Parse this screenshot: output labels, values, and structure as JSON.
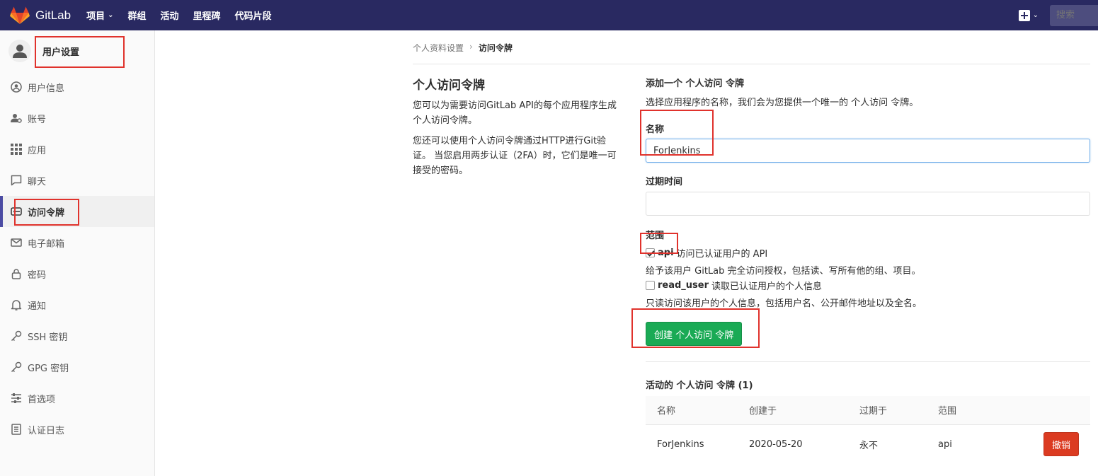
{
  "navbar": {
    "brand": "GitLab",
    "links": [
      {
        "label": "项目",
        "dropdown": true
      },
      {
        "label": "群组"
      },
      {
        "label": "活动"
      },
      {
        "label": "里程碑"
      },
      {
        "label": "代码片段"
      }
    ],
    "search_placeholder": "搜索"
  },
  "sidebar": {
    "title": "用户设置",
    "items": [
      {
        "label": "用户信息",
        "icon": "profile-icon"
      },
      {
        "label": "账号",
        "icon": "account-icon"
      },
      {
        "label": "应用",
        "icon": "applications-icon"
      },
      {
        "label": "聊天",
        "icon": "chat-icon"
      },
      {
        "label": "访问令牌",
        "icon": "token-icon",
        "active": true
      },
      {
        "label": "电子邮箱",
        "icon": "email-icon"
      },
      {
        "label": "密码",
        "icon": "lock-icon"
      },
      {
        "label": "通知",
        "icon": "bell-icon"
      },
      {
        "label": "SSH 密钥",
        "icon": "key-icon"
      },
      {
        "label": "GPG 密钥",
        "icon": "key-icon"
      },
      {
        "label": "首选项",
        "icon": "preferences-icon"
      },
      {
        "label": "认证日志",
        "icon": "log-icon"
      }
    ]
  },
  "breadcrumb": {
    "parent": "个人资料设置",
    "current": "访问令牌"
  },
  "intro": {
    "title": "个人访问令牌",
    "p1": "您可以为需要访问GitLab API的每个应用程序生成个人访问令牌。",
    "p2": "您还可以使用个人访问令牌通过HTTP进行Git验证。 当您启用两步认证（2FA）时，它们是唯一可接受的密码。"
  },
  "form": {
    "title": "添加一个 个人访问 令牌",
    "desc": "选择应用程序的名称，我们会为您提供一个唯一的 个人访问 令牌。",
    "name_label": "名称",
    "name_value": "ForJenkins",
    "expires_label": "过期时间",
    "expires_value": "",
    "scopes_label": "范围",
    "scopes": [
      {
        "name": "api",
        "desc": "访问已认证用户的 API",
        "help": "给予该用户 GitLab 完全访问授权，包括读、写所有他的组、项目。",
        "checked": true
      },
      {
        "name": "read_user",
        "desc": "读取已认证用户的个人信息",
        "help": "只读访问该用户的个人信息，包括用户名、公开邮件地址以及全名。",
        "checked": false
      }
    ],
    "submit_label": "创建 个人访问 令牌"
  },
  "active_tokens": {
    "title": "活动的 个人访问 令牌 (1)",
    "headers": [
      "名称",
      "创建于",
      "过期于",
      "范围"
    ],
    "rows": [
      {
        "name": "ForJenkins",
        "created": "2020-05-20",
        "expires": "永不",
        "scopes": "api",
        "action": "撤销"
      }
    ]
  },
  "colors": {
    "navbar": "#292961",
    "create_button": "#1aaa55",
    "revoke_button": "#db3b21",
    "annotation": "#e0322c"
  }
}
